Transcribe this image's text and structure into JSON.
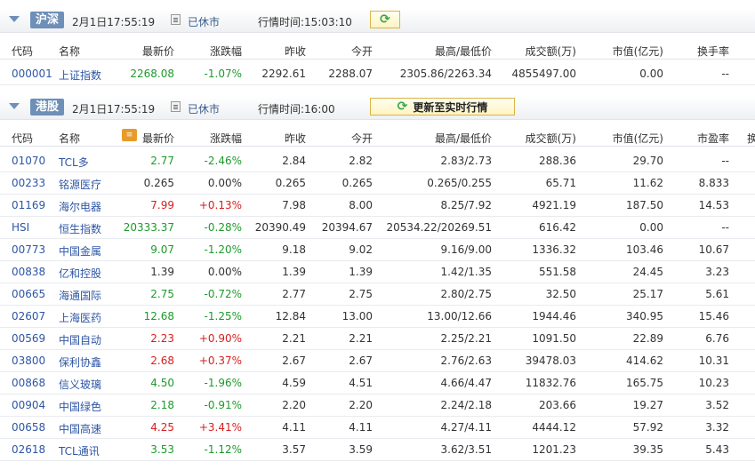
{
  "sh": {
    "market": "沪深",
    "date": "2月1日17:55:19",
    "status": "已休市",
    "time_label": "行情时间:15:03:10",
    "columns": [
      "代码",
      "名称",
      "最新价",
      "涨跌幅",
      "昨收",
      "今开",
      "最高/最低价",
      "成交额(万)",
      "市值(亿元)",
      "换手率"
    ],
    "rows": [
      {
        "code": "000001",
        "name": "上证指数",
        "price": "2268.08",
        "chg": "-1.07%",
        "prev": "2292.61",
        "open": "2288.07",
        "hl": "2305.86/2263.34",
        "amount": "4855497.00",
        "mcap": "0.00",
        "extra": "--",
        "dir": "dn"
      }
    ]
  },
  "hk": {
    "market": "港股",
    "date": "2月1日17:55:19",
    "status": "已休市",
    "time_label": "行情时间:16:00",
    "refresh_label": "更新至实时行情",
    "columns": [
      "代码",
      "名称",
      "最新价",
      "涨跌幅",
      "昨收",
      "今开",
      "最高/最低价",
      "成交额(万)",
      "市值(亿元)",
      "市盈率",
      "换"
    ],
    "rows": [
      {
        "code": "01070",
        "name": "TCL多",
        "price": "2.77",
        "chg": "-2.46%",
        "prev": "2.84",
        "open": "2.82",
        "hl": "2.83/2.73",
        "amount": "288.36",
        "mcap": "29.70",
        "extra": "--",
        "dir": "dn"
      },
      {
        "code": "00233",
        "name": "铭源医疗",
        "price": "0.265",
        "chg": "0.00%",
        "prev": "0.265",
        "open": "0.265",
        "hl": "0.265/0.255",
        "amount": "65.71",
        "mcap": "11.62",
        "extra": "8.833",
        "dir": "flat"
      },
      {
        "code": "01169",
        "name": "海尔电器",
        "price": "7.99",
        "chg": "+0.13%",
        "prev": "7.98",
        "open": "8.00",
        "hl": "8.25/7.92",
        "amount": "4921.19",
        "mcap": "187.50",
        "extra": "14.53",
        "dir": "up"
      },
      {
        "code": "HSI",
        "name": "恒生指数",
        "price": "20333.37",
        "chg": "-0.28%",
        "prev": "20390.49",
        "open": "20394.67",
        "hl": "20534.22/20269.51",
        "amount": "616.42",
        "mcap": "0.00",
        "extra": "--",
        "dir": "dn"
      },
      {
        "code": "00773",
        "name": "中国金属",
        "price": "9.07",
        "chg": "-1.20%",
        "prev": "9.18",
        "open": "9.02",
        "hl": "9.16/9.00",
        "amount": "1336.32",
        "mcap": "103.46",
        "extra": "10.67",
        "dir": "dn"
      },
      {
        "code": "00838",
        "name": "亿和控股",
        "price": "1.39",
        "chg": "0.00%",
        "prev": "1.39",
        "open": "1.39",
        "hl": "1.42/1.35",
        "amount": "551.58",
        "mcap": "24.45",
        "extra": "3.23",
        "dir": "flat"
      },
      {
        "code": "00665",
        "name": "海通国际",
        "price": "2.75",
        "chg": "-0.72%",
        "prev": "2.77",
        "open": "2.75",
        "hl": "2.80/2.75",
        "amount": "32.50",
        "mcap": "25.17",
        "extra": "5.61",
        "dir": "dn"
      },
      {
        "code": "02607",
        "name": "上海医药",
        "price": "12.68",
        "chg": "-1.25%",
        "prev": "12.84",
        "open": "13.00",
        "hl": "13.00/12.66",
        "amount": "1944.46",
        "mcap": "340.95",
        "extra": "15.46",
        "dir": "dn"
      },
      {
        "code": "00569",
        "name": "中国自动",
        "price": "2.23",
        "chg": "+0.90%",
        "prev": "2.21",
        "open": "2.21",
        "hl": "2.25/2.21",
        "amount": "1091.50",
        "mcap": "22.89",
        "extra": "6.76",
        "dir": "up"
      },
      {
        "code": "03800",
        "name": "保利协鑫",
        "price": "2.68",
        "chg": "+0.37%",
        "prev": "2.67",
        "open": "2.67",
        "hl": "2.76/2.63",
        "amount": "39478.03",
        "mcap": "414.62",
        "extra": "10.31",
        "dir": "up"
      },
      {
        "code": "00868",
        "name": "信义玻璃",
        "price": "4.50",
        "chg": "-1.96%",
        "prev": "4.59",
        "open": "4.51",
        "hl": "4.66/4.47",
        "amount": "11832.76",
        "mcap": "165.75",
        "extra": "10.23",
        "dir": "dn"
      },
      {
        "code": "00904",
        "name": "中国绿色",
        "price": "2.18",
        "chg": "-0.91%",
        "prev": "2.20",
        "open": "2.20",
        "hl": "2.24/2.18",
        "amount": "203.66",
        "mcap": "19.27",
        "extra": "3.52",
        "dir": "dn"
      },
      {
        "code": "00658",
        "name": "中国高速",
        "price": "4.25",
        "chg": "+3.41%",
        "prev": "4.11",
        "open": "4.11",
        "hl": "4.27/4.11",
        "amount": "4444.12",
        "mcap": "57.92",
        "extra": "3.32",
        "dir": "up"
      },
      {
        "code": "02618",
        "name": "TCL通讯",
        "price": "3.53",
        "chg": "-1.12%",
        "prev": "3.57",
        "open": "3.59",
        "hl": "3.62/3.51",
        "amount": "1201.23",
        "mcap": "39.35",
        "extra": "5.43",
        "dir": "dn"
      }
    ]
  }
}
